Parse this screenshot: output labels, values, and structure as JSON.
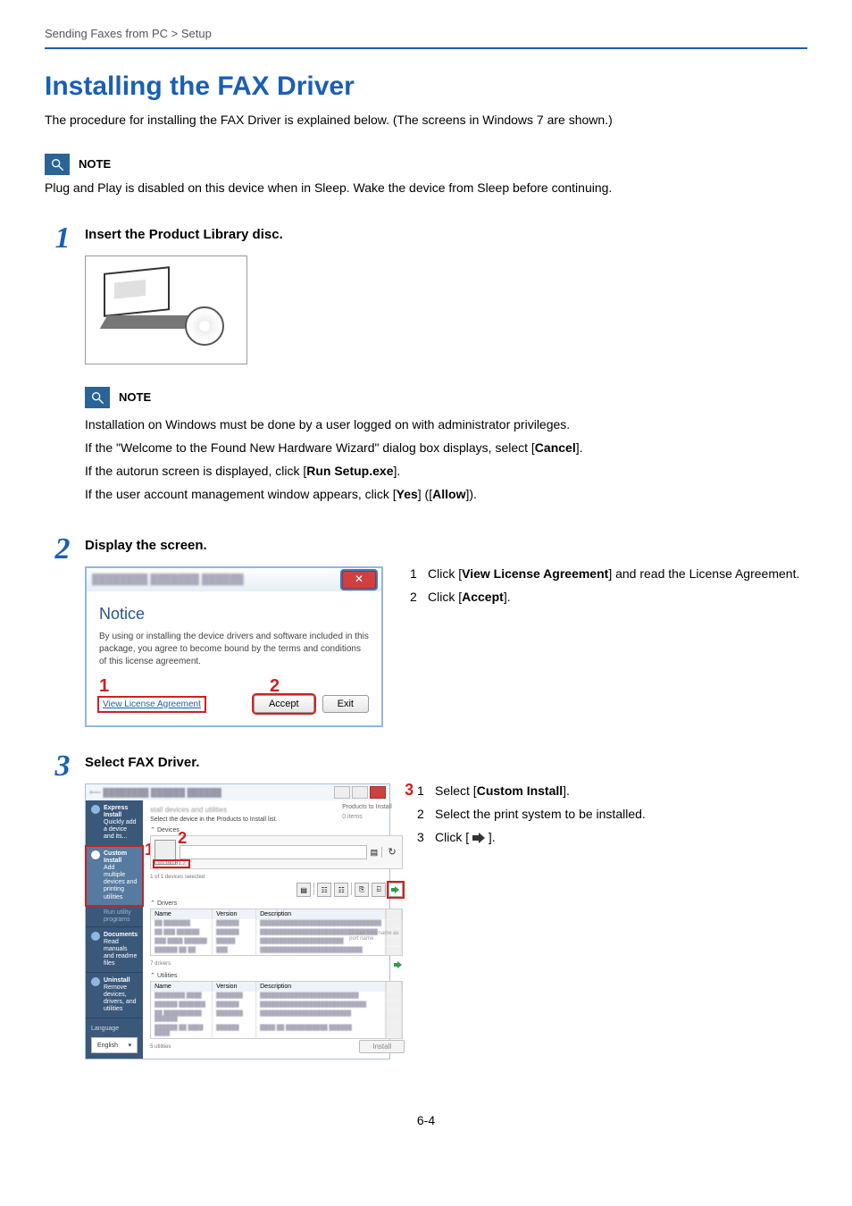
{
  "breadcrumb": "Sending Faxes from PC > Setup",
  "h1": "Installing the FAX Driver",
  "intro": "The procedure for installing the FAX Driver is explained below. (The screens in Windows 7 are shown.)",
  "note1": {
    "label": "NOTE",
    "text": "Plug and Play is disabled on this device when in Sleep. Wake the device from Sleep before continuing."
  },
  "step1": {
    "num": "1",
    "title_lead": "Insert the ",
    "title_bold": "Product Library disc",
    "title_tail": ".",
    "note_label": "NOTE",
    "p1_a": "Installation on Windows must be done by a user logged on with administrator privileges.",
    "p2_a": "If the \"Welcome to the Found New Hardware Wizard\" dialog box displays, select [",
    "p2_b": "Cancel",
    "p2_c": "].",
    "p3_a": "If the autorun screen is displayed, click [",
    "p3_b": "Run Setup.exe",
    "p3_c": "].",
    "p4_a": "If the user account management window appears, click [",
    "p4_b": "Yes",
    "p4_c": "] ([",
    "p4_d": "Allow",
    "p4_e": "])."
  },
  "step2": {
    "num": "2",
    "title": "Display the screen.",
    "dialog": {
      "notice": "Notice",
      "msg": "By using or installing the device drivers and software included in this package, you agree to become bound by the terms and conditions of this license agreement.",
      "link": "View License Agreement",
      "accept": "Accept",
      "exit": "Exit",
      "callout1": "1",
      "callout2": "2"
    },
    "side": {
      "l1a": "Click [",
      "l1b": "View License Agreement",
      "l1c": "] and read the License Agreement.",
      "l2a": "Click [",
      "l2b": "Accept",
      "l2c": "]."
    }
  },
  "step3": {
    "num": "3",
    "title": "Select FAX Driver.",
    "installer": {
      "sidebar": {
        "express_t": "Express Install",
        "express_s": "Quickly add a device and its...",
        "custom_t": "Custom Install",
        "custom_s": "Add multiple devices and printing utilities",
        "maint": "Run utility programs",
        "docs_t": "Documents",
        "docs_s": "Read manuals and readme files",
        "uninstall_t": "Uninstall",
        "uninstall_s": "Remove devices, drivers, and utilities",
        "language_label": "Language",
        "language_value": "English"
      },
      "main": {
        "header_blur": "stall devices and utilities",
        "sub": "Select the device in the Products to Install list.",
        "devices_hdr": "Devices",
        "devices_count": "1 of 1 devices selected",
        "ip": "10.180.81.2",
        "drivers_hdr": "Drivers",
        "col_name": "Name",
        "col_version": "Version",
        "col_desc": "Description",
        "drivers_count": "7 drivers",
        "util_hdr": "Utilities",
        "util_count": "5 utilities",
        "right_t": "Products to Install",
        "right_c": "0 items",
        "hostnote": "Use host name as port name",
        "install": "Install",
        "callout1": "1",
        "callout2": "2",
        "callout3": "3"
      }
    },
    "side": {
      "l1a": "Select [",
      "l1b": "Custom Install",
      "l1c": "].",
      "l2": "Select the print system to be installed.",
      "l3a": "Click [ ",
      "l3b": " ]."
    }
  },
  "page_num": "6-4"
}
